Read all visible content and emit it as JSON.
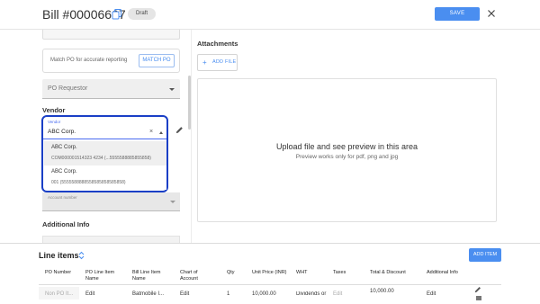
{
  "header": {
    "title": "Bill #00006667",
    "status": "Draft",
    "save_label": "SAVE"
  },
  "left_panel": {
    "match_po_text": "Match PO for accurate reporting",
    "match_po_button": "MATCH PO",
    "po_requestor_label": "PO Requestor",
    "vendor_section": "Vendor",
    "vendor_field_label": "Vendor",
    "vendor_value": "ABC Corp.",
    "vendor_options": [
      {
        "name": "ABC Corp.",
        "sub": "COM000001514323 4234   (...5555588885855858)"
      },
      {
        "name": "ABC Corp.",
        "sub": "001   (5555588888558585858585858)"
      }
    ],
    "account_number_label": "Account number",
    "additional_info": "Additional Info"
  },
  "attachments": {
    "title": "Attachments",
    "add_file": "ADD FILE",
    "upload_main": "Upload file and see preview in this area",
    "upload_sub": "Preview works only for pdf, png and jpg"
  },
  "line_items": {
    "title": "Line items",
    "add_item": "ADD ITEM",
    "columns": [
      "PO Number",
      "PO Line Item Name",
      "Bill Line Item Name",
      "Chart of Account",
      "Qty",
      "Unit Price (INR)",
      "WHT",
      "Taxes",
      "Total & Discount",
      "Additional Info"
    ],
    "row": [
      "Non PO It...",
      "Edit",
      "Batmobile I...",
      "Edit",
      "1",
      "10,000.00",
      "Dividends or",
      "Edit",
      "10,000.00",
      "Edit"
    ]
  },
  "colors": {
    "primary": "#4a8ef0",
    "focus_border": "#1a3fc6"
  }
}
